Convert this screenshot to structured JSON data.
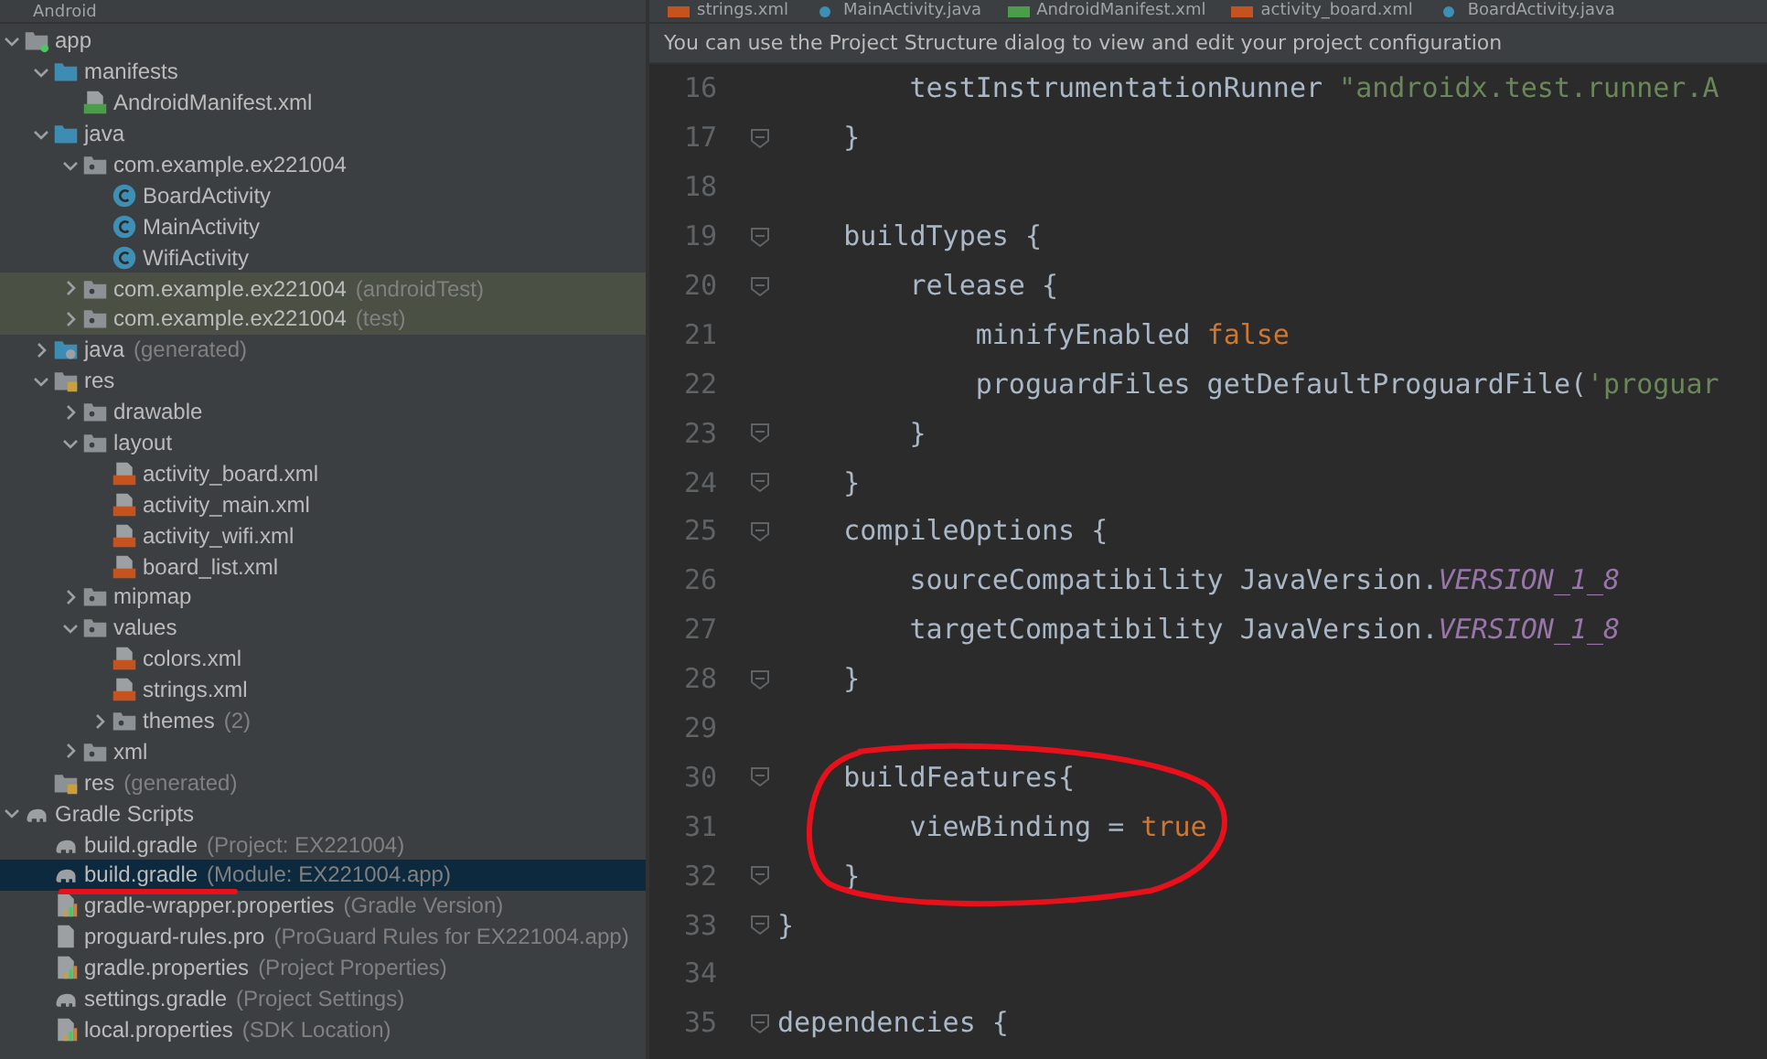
{
  "project_panel": {
    "title": "Android",
    "tree": [
      {
        "label": "app",
        "kind": "module",
        "expanded": true,
        "selected": false,
        "tinted": false,
        "children": [
          {
            "label": "manifests",
            "kind": "folder",
            "expanded": true,
            "selected": false,
            "tinted": false,
            "children": [
              {
                "label": "AndroidManifest.xml",
                "kind": "manifest",
                "selected": false,
                "tinted": false
              }
            ]
          },
          {
            "label": "java",
            "kind": "folder",
            "expanded": true,
            "selected": false,
            "tinted": false,
            "children": [
              {
                "label": "com.example.ex221004",
                "kind": "package",
                "expanded": true,
                "selected": false,
                "tinted": false,
                "children": [
                  {
                    "label": "BoardActivity",
                    "kind": "class",
                    "selected": false,
                    "tinted": false
                  },
                  {
                    "label": "MainActivity",
                    "kind": "class",
                    "selected": false,
                    "tinted": false
                  },
                  {
                    "label": "WifiActivity",
                    "kind": "class",
                    "selected": false,
                    "tinted": false
                  }
                ]
              },
              {
                "label": "com.example.ex221004",
                "hint": "(androidTest)",
                "kind": "package",
                "expanded": false,
                "selected": false,
                "tinted": true
              },
              {
                "label": "com.example.ex221004",
                "hint": "(test)",
                "kind": "package",
                "expanded": false,
                "selected": false,
                "tinted": true
              }
            ]
          },
          {
            "label": "java",
            "hint": "(generated)",
            "kind": "generated",
            "expanded": false,
            "selected": false,
            "tinted": false
          },
          {
            "label": "res",
            "kind": "resources",
            "expanded": true,
            "selected": false,
            "tinted": false,
            "children": [
              {
                "label": "drawable",
                "kind": "package",
                "expanded": false,
                "selected": false,
                "tinted": false
              },
              {
                "label": "layout",
                "kind": "package",
                "expanded": true,
                "selected": false,
                "tinted": false,
                "children": [
                  {
                    "label": "activity_board.xml",
                    "kind": "xml",
                    "selected": false,
                    "tinted": false
                  },
                  {
                    "label": "activity_main.xml",
                    "kind": "xml",
                    "selected": false,
                    "tinted": false
                  },
                  {
                    "label": "activity_wifi.xml",
                    "kind": "xml",
                    "selected": false,
                    "tinted": false
                  },
                  {
                    "label": "board_list.xml",
                    "kind": "xml",
                    "selected": false,
                    "tinted": false
                  }
                ]
              },
              {
                "label": "mipmap",
                "kind": "package",
                "expanded": false,
                "selected": false,
                "tinted": false
              },
              {
                "label": "values",
                "kind": "package",
                "expanded": true,
                "selected": false,
                "tinted": false,
                "children": [
                  {
                    "label": "colors.xml",
                    "kind": "xml",
                    "selected": false,
                    "tinted": false
                  },
                  {
                    "label": "strings.xml",
                    "kind": "xml",
                    "selected": false,
                    "tinted": false
                  },
                  {
                    "label": "themes",
                    "hint": "(2)",
                    "kind": "package",
                    "expanded": false,
                    "selected": false,
                    "tinted": false
                  }
                ]
              },
              {
                "label": "xml",
                "kind": "package",
                "expanded": false,
                "selected": false,
                "tinted": false
              }
            ]
          },
          {
            "label": "res",
            "hint": "(generated)",
            "kind": "resources",
            "selected": false,
            "tinted": false
          }
        ]
      },
      {
        "label": "Gradle Scripts",
        "kind": "gradle",
        "expanded": true,
        "selected": false,
        "tinted": false,
        "children": [
          {
            "label": "build.gradle",
            "hint": "(Project: EX221004)",
            "kind": "gradle",
            "selected": false,
            "tinted": false
          },
          {
            "label": "build.gradle",
            "hint": "(Module: EX221004.app)",
            "kind": "gradle",
            "selected": true,
            "tinted": false
          },
          {
            "label": "gradle-wrapper.properties",
            "hint": "(Gradle Version)",
            "kind": "properties",
            "selected": false,
            "tinted": false
          },
          {
            "label": "proguard-rules.pro",
            "hint": "(ProGuard Rules for EX221004.app)",
            "kind": "file",
            "selected": false,
            "tinted": false
          },
          {
            "label": "gradle.properties",
            "hint": "(Project Properties)",
            "kind": "properties",
            "selected": false,
            "tinted": false
          },
          {
            "label": "settings.gradle",
            "hint": "(Project Settings)",
            "kind": "gradle",
            "selected": false,
            "tinted": false
          },
          {
            "label": "local.properties",
            "hint": "(SDK Location)",
            "kind": "properties",
            "selected": false,
            "tinted": false
          }
        ]
      }
    ]
  },
  "editor": {
    "tabs": [
      {
        "label": "strings.xml",
        "kind": "xml",
        "selected": false
      },
      {
        "label": "MainActivity.java",
        "kind": "class",
        "selected": false
      },
      {
        "label": "AndroidManifest.xml",
        "kind": "manifest",
        "selected": false
      },
      {
        "label": "activity_board.xml",
        "kind": "xml",
        "selected": false
      },
      {
        "label": "BoardActivity.java",
        "kind": "class",
        "selected": false
      }
    ],
    "notice": "You can use the Project Structure dialog to view and edit your project configuration",
    "lines": [
      {
        "number": "16",
        "fold": false,
        "tokens": [
          {
            "t": "        testInstrumentationRunner ",
            "kind": "plain"
          },
          {
            "t": "\"androidx.test.runner.A",
            "kind": "string"
          }
        ]
      },
      {
        "number": "17",
        "fold": true,
        "tokens": [
          {
            "t": "    }",
            "kind": "plain"
          }
        ]
      },
      {
        "number": "18",
        "fold": false
      },
      {
        "number": "19",
        "fold": true,
        "tokens": [
          {
            "t": "    buildTypes {",
            "kind": "plain"
          }
        ]
      },
      {
        "number": "20",
        "fold": true,
        "tokens": [
          {
            "t": "        release {",
            "kind": "plain"
          }
        ]
      },
      {
        "number": "21",
        "fold": false,
        "tokens": [
          {
            "t": "            minifyEnabled ",
            "kind": "plain"
          },
          {
            "t": "false",
            "kind": "keyword"
          }
        ]
      },
      {
        "number": "22",
        "fold": false,
        "tokens": [
          {
            "t": "            proguardFiles getDefaultProguardFile(",
            "kind": "plain"
          },
          {
            "t": "'proguar",
            "kind": "string"
          }
        ]
      },
      {
        "number": "23",
        "fold": true,
        "tokens": [
          {
            "t": "        }",
            "kind": "plain"
          }
        ]
      },
      {
        "number": "24",
        "fold": true,
        "tokens": [
          {
            "t": "    }",
            "kind": "plain"
          }
        ]
      },
      {
        "number": "25",
        "fold": true,
        "tokens": [
          {
            "t": "    compileOptions {",
            "kind": "plain"
          }
        ]
      },
      {
        "number": "26",
        "fold": false,
        "tokens": [
          {
            "t": "        sourceCompatibility JavaVersion.",
            "kind": "plain"
          },
          {
            "t": "VERSION_1_8",
            "kind": "constant"
          }
        ]
      },
      {
        "number": "27",
        "fold": false,
        "tokens": [
          {
            "t": "        targetCompatibility JavaVersion.",
            "kind": "plain"
          },
          {
            "t": "VERSION_1_8",
            "kind": "constant"
          }
        ]
      },
      {
        "number": "28",
        "fold": true,
        "tokens": [
          {
            "t": "    }",
            "kind": "plain"
          }
        ]
      },
      {
        "number": "29",
        "fold": false
      },
      {
        "number": "30",
        "fold": true,
        "tokens": [
          {
            "t": "    buildFeatures{",
            "kind": "plain"
          }
        ]
      },
      {
        "number": "31",
        "fold": false,
        "tokens": [
          {
            "t": "        viewBinding = ",
            "kind": "plain"
          },
          {
            "t": "true",
            "kind": "keyword"
          }
        ]
      },
      {
        "number": "32",
        "fold": true,
        "tokens": [
          {
            "t": "    }",
            "kind": "plain"
          }
        ]
      },
      {
        "number": "33",
        "fold": true,
        "tokens": [
          {
            "t": "}",
            "kind": "plain"
          }
        ]
      },
      {
        "number": "34",
        "fold": false
      },
      {
        "number": "35",
        "fold": true,
        "tokens": [
          {
            "t": "dependencies {",
            "kind": "plain"
          }
        ]
      }
    ]
  }
}
